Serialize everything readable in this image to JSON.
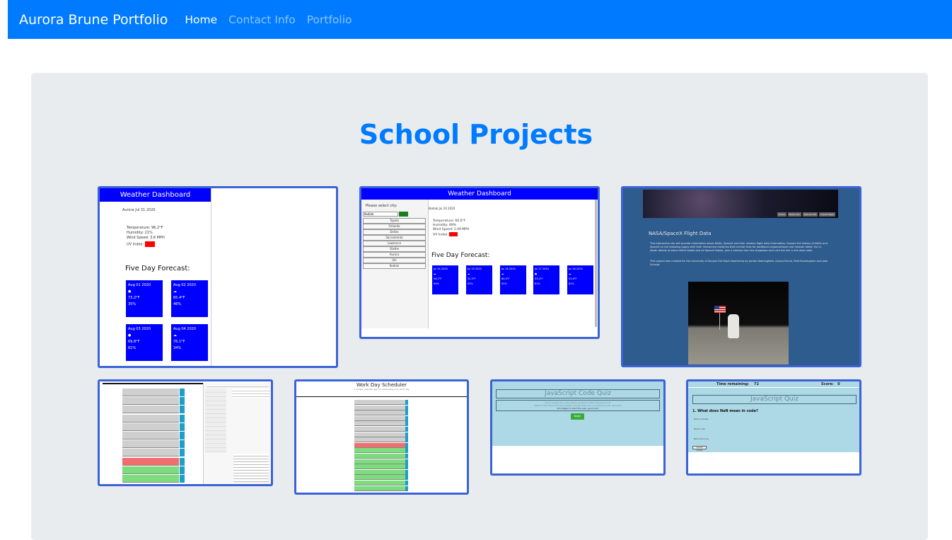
{
  "navbar": {
    "brand": "Aurora Brune Portfolio",
    "links": [
      "Home",
      "Contact Info",
      "Portfolio"
    ],
    "colors": {
      "bg": "#007bff",
      "active": "#ffffff",
      "inactive": "rgba(255,255,255,0.55)"
    }
  },
  "main": {
    "title": "School Projects"
  },
  "projects": {
    "weather1": {
      "header": "Weather Dashboard",
      "city": "Aurora Jul 31 2020",
      "temp": "Temperature: 96.2°F",
      "humidity": "Humidity: 21%",
      "wind": "Wind Speed: 3.6 MPH",
      "uv": "UV Index:",
      "forecast": "Five Day Forecast:",
      "cards": [
        {
          "date": "Aug 01 2020",
          "temp": "73.2°F",
          "hum": "35%"
        },
        {
          "date": "Aug 02 2020",
          "temp": "65.4°F",
          "hum": "46%"
        },
        {
          "date": "Aug 03 2020",
          "temp": "69.8°F",
          "hum": "61%"
        },
        {
          "date": "Aug 04 2020",
          "temp": "76.1°F",
          "hum": "34%"
        }
      ]
    },
    "weather2": {
      "header": "Weather Dashboard",
      "prompt": "Please select city:",
      "input": "Kodiak",
      "cities": [
        "Tupelo",
        "Orlando",
        "Dallas",
        "Sacramento",
        "Lawrence",
        "Olathe",
        "Aurora",
        "Ulli",
        "Kodiak"
      ],
      "city": "Kodiak Jul 24 2020",
      "temp": "Temperature: 60.0°F",
      "humidity": "Humidity: 89%",
      "wind": "Wind Speed: 1.09 MPH",
      "uv": "UV Index:",
      "forecast": "Five Day Forecast:",
      "cards": [
        {
          "date": "Jul 24 2020",
          "temp": "56.2°F",
          "hum": "94%"
        },
        {
          "date": "Jul 25 2020",
          "temp": "52.3°F",
          "hum": "93%"
        },
        {
          "date": "Jul 26 2020",
          "temp": "60.0°F",
          "hum": "92%"
        },
        {
          "date": "Jul 27 2020",
          "temp": "53.4°F",
          "hum": "81%"
        },
        {
          "date": "Jul 28 2020",
          "temp": "52.6°F",
          "hum": "81%"
        }
      ]
    },
    "nasa": {
      "nav": [
        "Home",
        "NASA Info",
        "SpaceX Info",
        "Impact Page"
      ],
      "heading": "NASA/SpaceX Flight Data",
      "para1": "This interactive site will provide information about NASA, SpaceX and their relative flight data information. Explore the history of NASA and SpaceX on the following pages with their interactive timelines that include links for additional organizational and mission detail. For in-depth details of select NASA flights and all SpaceX flights, pick a mission from the dropdown and click the link in the data table.",
      "para2": "This project was created for the University of Kansas Full Stack BootCamp by Jordan Beeningfield, Aurora Brune, Reid Buckingham and Julia Schaub."
    },
    "scheduler2": {
      "header": "Work Day Scheduler",
      "sub": "A simple calendar app for scheduling your work day"
    },
    "quiz1": {
      "header": "JavaScript Code Quiz",
      "line1": "Try to answer the code-related questions within the time limit.",
      "line2": "Keep in mind that incorrect answers will penalize your score/time by ten seconds!",
      "line3": "Click Begin to start the quiz, good luck!",
      "button": "Begin"
    },
    "quiz2": {
      "time_label": "Time remaining:",
      "time_value": "72",
      "score_label": "Score:",
      "score_value": "0",
      "header": "JavaScript Quiz",
      "question": "1. What does NaN mean in code?",
      "answers": [
        "Not a number",
        "Never null",
        "Nine and nine"
      ],
      "button": "Submit Answer"
    }
  }
}
